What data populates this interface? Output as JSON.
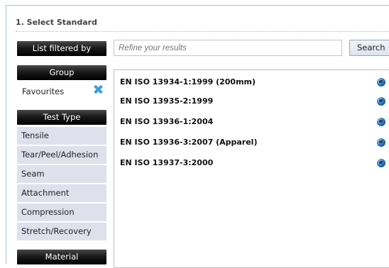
{
  "section": {
    "title": "1. Select Standard"
  },
  "filter": {
    "header": "List filtered by",
    "search_placeholder": "Refine your results",
    "search_button": "Search"
  },
  "group": {
    "header": "Group",
    "favourites_label": "Favourites",
    "remove_icon": "close-x-icon"
  },
  "test_type": {
    "header": "Test Type",
    "items": [
      "Tensile",
      "Tear/Peel/Adhesion",
      "Seam",
      "Attachment",
      "Compression",
      "Stretch/Recovery"
    ]
  },
  "material": {
    "header": "Material"
  },
  "results": {
    "icon": "globe-icon",
    "items": [
      "EN ISO 13934-1:1999 (200mm)",
      "EN ISO 13935-2:1999",
      "EN ISO 13936-1:2004",
      "EN ISO 13936-3:2007 (Apparel)",
      "EN ISO 13937-3:2000"
    ]
  },
  "colors": {
    "frame": "#a9c3d6",
    "side_item_bg": "#e0e0ec",
    "remove_icon": "#3a9ee0",
    "header_bg": "#000000"
  }
}
